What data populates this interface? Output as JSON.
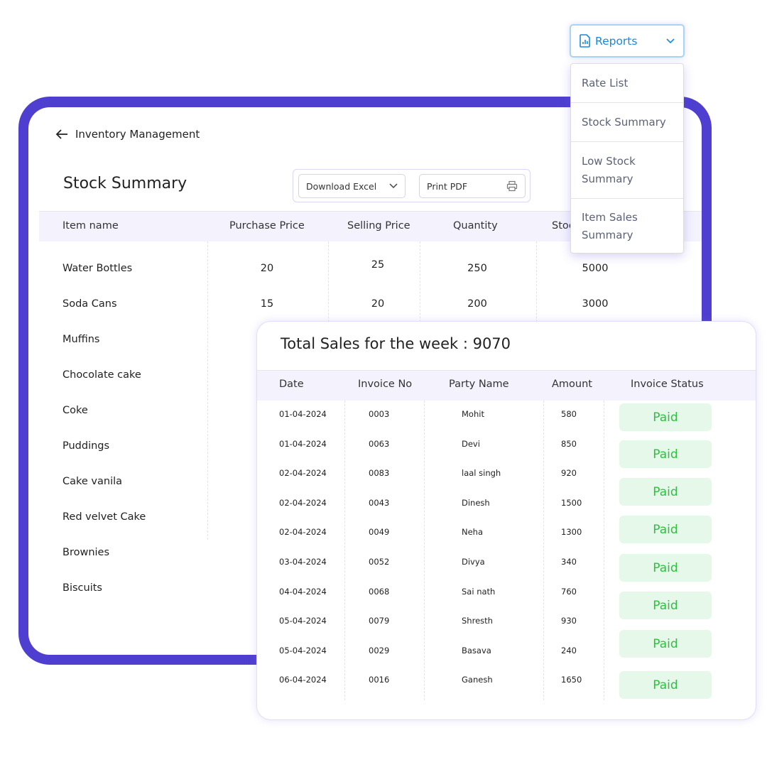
{
  "header": {
    "back_label": "Inventory Management",
    "title": "Stock Summary",
    "download_label": "Download Excel",
    "print_label": "Print PDF"
  },
  "stock_table": {
    "columns": [
      "Item name",
      "Purchase Price",
      "Selling Price",
      "Quantity",
      "Stock"
    ],
    "rows": [
      [
        "Water Bottles",
        "20",
        "25",
        "250",
        "5000"
      ],
      [
        "Soda Cans",
        "15",
        "20",
        "200",
        "3000"
      ],
      [
        "Muffins"
      ],
      [
        "Chocolate cake"
      ],
      [
        "Coke"
      ],
      [
        "Puddings"
      ],
      [
        "Cake vanila"
      ],
      [
        "Red velvet Cake"
      ],
      [
        "Brownies"
      ],
      [
        "Biscuits"
      ]
    ]
  },
  "reports": {
    "label": "Reports",
    "items": [
      "Rate List",
      "Stock Summary",
      "Low Stock Summary",
      "Item Sales Summary"
    ]
  },
  "sales": {
    "title": "Total Sales for the week : 9070",
    "columns": [
      "Date",
      "Invoice No",
      "Party Name",
      "Amount",
      "Invoice Status"
    ],
    "rows": [
      [
        "01-04-2024",
        "0003",
        "Mohit",
        "580"
      ],
      [
        "01-04-2024",
        "0063",
        "Devi",
        "850"
      ],
      [
        "02-04-2024",
        "0083",
        "laal singh",
        "920"
      ],
      [
        "02-04-2024",
        "0043",
        "Dinesh",
        "1500"
      ],
      [
        "02-04-2024",
        "0049",
        "Neha",
        "1300"
      ],
      [
        "03-04-2024",
        "0052",
        "Divya",
        "340"
      ],
      [
        "04-04-2024",
        "0068",
        "Sai nath",
        "760"
      ],
      [
        "05-04-2024",
        "0079",
        "Shresth",
        "930"
      ],
      [
        "05-04-2024",
        "0029",
        "Basava",
        "240"
      ],
      [
        "06-04-2024",
        "0016",
        "Ganesh",
        "1650"
      ]
    ],
    "statuses": [
      "Paid",
      "Paid",
      "Paid",
      "Paid",
      "Paid",
      "Paid",
      "Paid",
      "Paid"
    ]
  },
  "colors": {
    "frame": "#4f3fd1",
    "accent": "#1a88e0",
    "paid_text": "#2fbf40",
    "paid_bg": "#e6f8ea"
  }
}
